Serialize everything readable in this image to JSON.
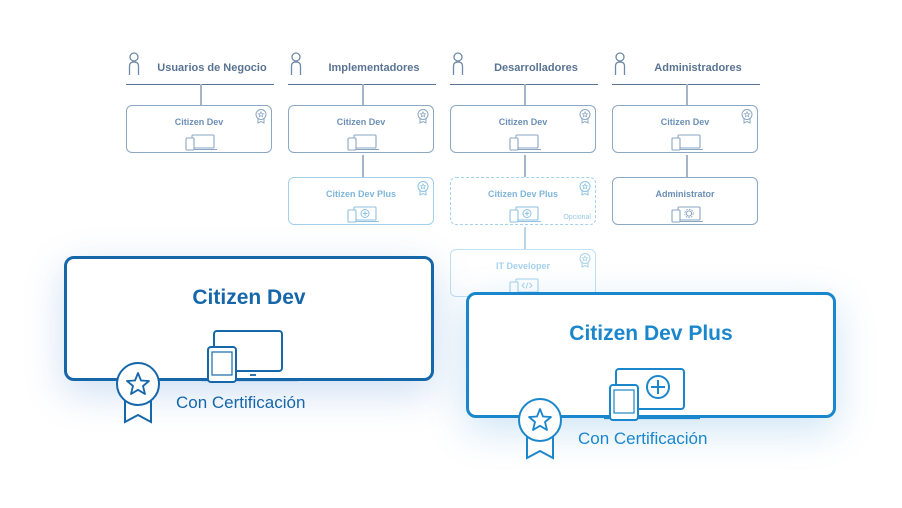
{
  "columns": [
    {
      "header": "Usuarios de Negocio"
    },
    {
      "header": "Implementadores"
    },
    {
      "header": "Desarrolladores"
    },
    {
      "header": "Administradores"
    }
  ],
  "boxes": {
    "c1_row1": {
      "title": "Citizen Dev"
    },
    "c2_row1": {
      "title": "Citizen Dev"
    },
    "c2_row2": {
      "title": "Citizen Dev Plus"
    },
    "c3_row1": {
      "title": "Citizen Dev"
    },
    "c3_row2": {
      "title": "Citizen Dev Plus",
      "tag": "Opcional"
    },
    "c3_row3": {
      "title": "IT Developer"
    },
    "c4_row1": {
      "title": "Citizen Dev"
    },
    "c4_row2": {
      "title": "Administrator"
    }
  },
  "highlight": [
    {
      "title": "Citizen Dev",
      "cert": "Con Certificación"
    },
    {
      "title": "Citizen Dev Plus",
      "cert": "Con Certificación"
    }
  ],
  "icons": {
    "person": "person-icon",
    "devices": "devices-icon",
    "devices_plus": "devices-plus-icon",
    "devices_gear": "devices-gear-icon",
    "devices_code": "devices-code-icon",
    "medal": "medal-star-icon"
  },
  "colors": {
    "header": "#5a7391",
    "box_border": "#8aa7c3",
    "box_light": "#a3d0ec",
    "big1": "#1667aa",
    "big2": "#1a87cc"
  }
}
